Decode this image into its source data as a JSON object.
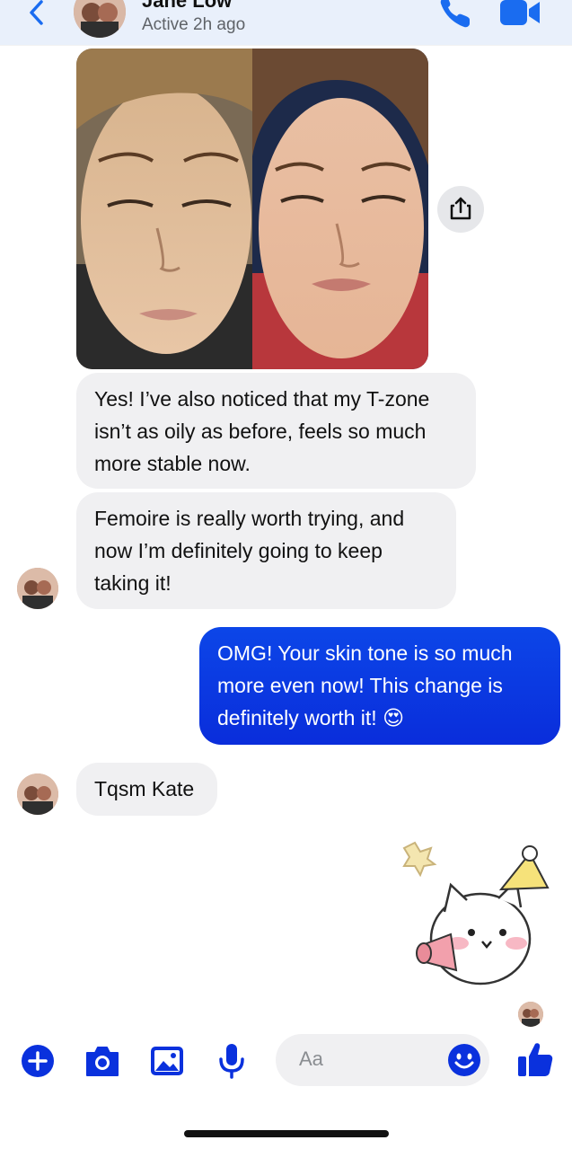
{
  "header": {
    "contact_name": "Jane Low",
    "status": "Active 2h ago",
    "back_icon": "chevron-left-icon",
    "call_icon": "phone-icon",
    "video_icon": "video-camera-icon"
  },
  "photo": {
    "description_icon": "before-after-face-photo",
    "share_icon": "share-icon"
  },
  "messages": [
    {
      "from": "contact",
      "text": "Yes! I’ve also noticed that my T-zone isn’t as oily as before,  feels so much more stable now."
    },
    {
      "from": "contact",
      "text": "Femoire is really worth trying, and now I’m definitely going to keep taking it!"
    },
    {
      "from": "me",
      "text": "OMG! Your skin tone is so much more even now! This change is definitely worth it! 😍"
    },
    {
      "from": "contact",
      "text": "Tqsm Kate"
    }
  ],
  "sticker": {
    "icon": "party-cat-sticker"
  },
  "composer": {
    "placeholder": "Aa",
    "icons": [
      "plus-icon",
      "camera-icon",
      "image-icon",
      "microphone-icon",
      "emoji-icon",
      "thumbs-up-icon"
    ]
  },
  "colors": {
    "accent": "#0a31dd",
    "header_bg": "#e9f0fb",
    "incoming_bubble": "#f0f0f2",
    "outgoing_bubble": "#0b3be4"
  }
}
